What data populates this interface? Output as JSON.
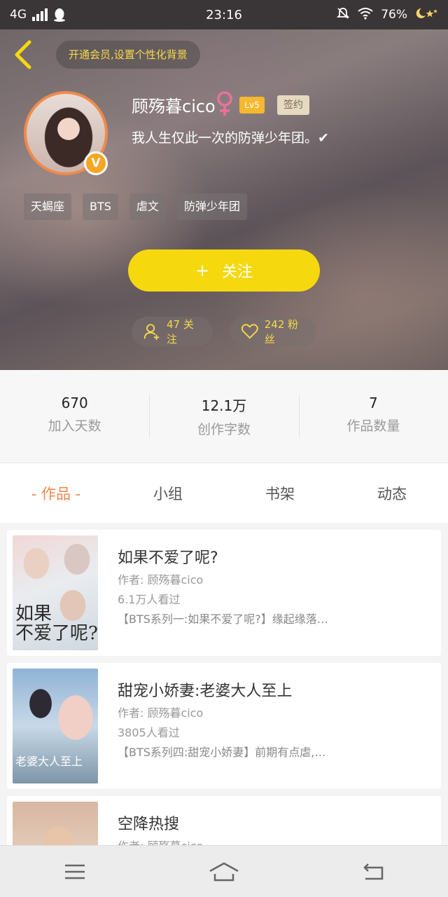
{
  "status_bar": {
    "network": "4G",
    "time": "23:16",
    "battery": "76%"
  },
  "header": {
    "member_prompt": "开通会员,设置个性化背景"
  },
  "profile": {
    "username": "顾殇暮cico",
    "level": "Lv5",
    "sign_badge": "签约",
    "verified_badge": "V",
    "bio": "我人生仅此一次的防弹少年团。✔",
    "tags": [
      "天蝎座",
      "BTS",
      "虐文",
      "防弹少年团"
    ],
    "follow_button": "关注",
    "follow_plus": "+",
    "following_text": "47 关注",
    "fans_text": "242 粉丝"
  },
  "stats": [
    {
      "value": "670",
      "label": "加入天数"
    },
    {
      "value": "12.1万",
      "label": "创作字数"
    },
    {
      "value": "7",
      "label": "作品数量"
    }
  ],
  "tabs": [
    "- 作品 -",
    "小组",
    "书架",
    "动态"
  ],
  "works": [
    {
      "title": "如果不爱了呢?",
      "author": "作者: 顾殇暮cico",
      "views": "6.1万人看过",
      "desc": "【BTS系列一:如果不爱了呢?】缘起缘落…",
      "cover_text": "如果\n不爱了呢?"
    },
    {
      "title": "甜宠小娇妻:老婆大人至上",
      "author": "作者: 顾殇暮cico",
      "views": "3805人看过",
      "desc": "【BTS系列四:甜宠小娇妻】前期有点虐,…",
      "cover_text": "老婆大人至上"
    },
    {
      "title": "空降热搜",
      "author": "作者: 顾殇暮cico",
      "views": "",
      "desc": "",
      "cover_text": ""
    }
  ],
  "colors": {
    "accent_yellow": "#f6d80f",
    "active_tab": "#f0864a",
    "avatar_ring": "#f08a4b",
    "gender": "#e8739a"
  }
}
